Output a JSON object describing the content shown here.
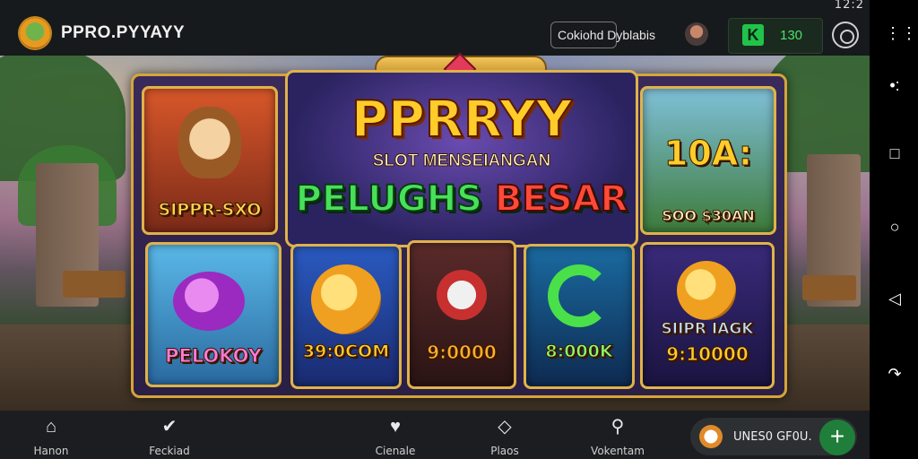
{
  "status_bar": {
    "time": "12:2"
  },
  "header": {
    "app_title": "PPRO.PYYAYY",
    "pill_text": "Cokiohd Dyblabis",
    "coin_value": "130",
    "coin_icon": "k-icon",
    "settings_icon": "settings-icon"
  },
  "banner": {
    "title": "PPRRYY",
    "subtitle": "SLOT MENSEIANGAN",
    "headline_left": "PELUGHS",
    "headline_right": "BESAR"
  },
  "tiles": {
    "top_left": "SIPPR-SXO",
    "top_right_big": "10A:",
    "top_right_small": "SOO $30AN",
    "bottom_1": "PELOKOY",
    "bottom_2": "39:0COM",
    "bottom_3": "9:0000",
    "bottom_4": "8:000K",
    "bottom_5_line1": "SIIPR IAGK",
    "bottom_5_line2": "9:10000"
  },
  "bottom_nav": {
    "items": [
      {
        "label": "Hanon",
        "icon": "home-icon"
      },
      {
        "label": "Feckiad",
        "icon": "check-icon"
      },
      {
        "label": "Cienale",
        "icon": "heart-icon"
      },
      {
        "label": "Plaos",
        "icon": "layers-icon"
      },
      {
        "label": "Vokentam",
        "icon": "search-icon"
      }
    ],
    "promo_text": "UNES0 GF0U.",
    "plus_label": "+"
  },
  "system_nav": {
    "icons": [
      "dots-icon",
      "more-icon",
      "recent-apps-icon",
      "home-circle-icon",
      "back-icon",
      "rotate-icon"
    ]
  }
}
